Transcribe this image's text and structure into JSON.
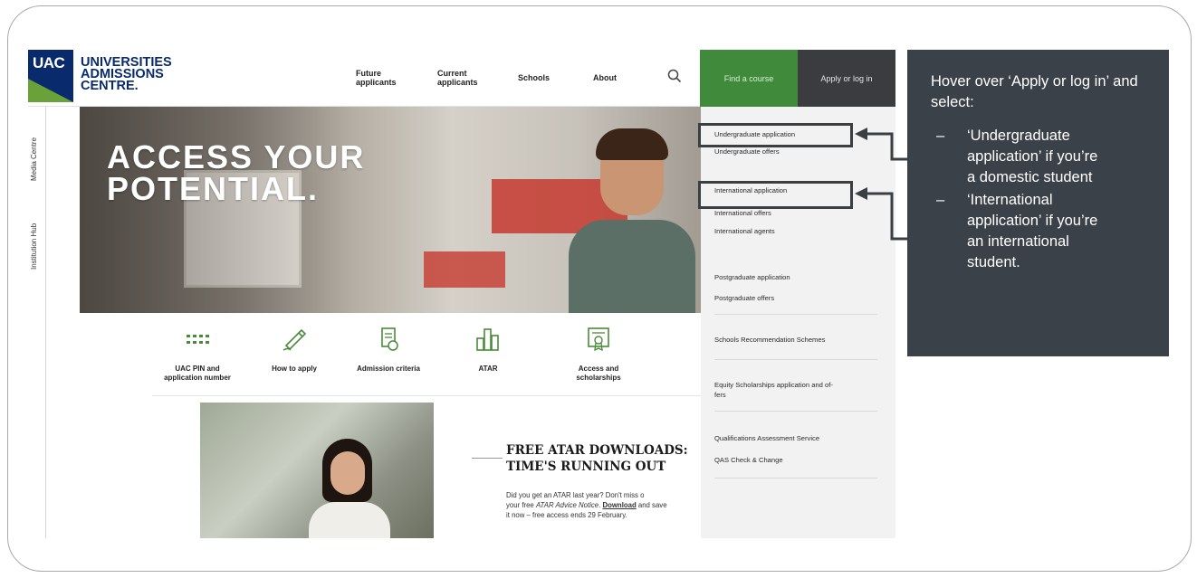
{
  "site": {
    "logo": {
      "short": "UAC",
      "line1": "UNIVERSITIES",
      "line2": "ADMISSIONS",
      "line3": "CENTRE."
    },
    "nav": [
      {
        "line1": "Future",
        "line2": "applicants"
      },
      {
        "line1": "Current",
        "line2": "applicants"
      },
      {
        "line1": "Schools",
        "line2": ""
      },
      {
        "line1": "About",
        "line2": ""
      }
    ],
    "find_course": "Find a course",
    "apply_login": "Apply or log in",
    "side_labels": {
      "media": "Media Centre",
      "institution": "Institution Hub"
    },
    "hero_line1": "ACCESS YOUR",
    "hero_line2": "POTENTIAL.",
    "quick_links": [
      {
        "line1": "UAC PIN and",
        "line2": "application number",
        "icon": "pin-dots-icon"
      },
      {
        "line1": "How to apply",
        "line2": "",
        "icon": "pencil-icon"
      },
      {
        "line1": "Admission criteria",
        "line2": "",
        "icon": "document-check-icon"
      },
      {
        "line1": "ATAR",
        "line2": "",
        "icon": "bar-chart-icon"
      },
      {
        "line1": "Access and",
        "line2": "scholarships",
        "icon": "certificate-icon"
      }
    ],
    "feature": {
      "title_line1": "FREE ATAR DOWNLOADS:",
      "title_line2": "TIME'S RUNNING OUT",
      "body_line1": "Did you get an ATAR last year? Don't miss o",
      "body_line2_a": "your free ",
      "body_line2_em": "ATAR Advice Notice",
      "body_line2_b": ". ",
      "body_line2_link": "Download",
      "body_line2_c": " and save",
      "body_line3": "it now – free access ends 29 February."
    },
    "dropdown": [
      "Undergraduate application",
      "Undergraduate offers",
      "International application",
      "International offers",
      "International agents",
      "Postgraduate application",
      "Postgraduate offers",
      "Schools Recommendation Schemes",
      "Equity Scholarships application and of-",
      "fers",
      "Qualifications Assessment Service",
      "QAS Check & Change"
    ]
  },
  "callout": {
    "intro": "Hover over ‘Apply or log in’ and select:",
    "bullets": [
      {
        "dash": "–",
        "lines": [
          "‘Undergraduate",
          "application’ if you’re",
          "a domestic student"
        ]
      },
      {
        "dash": "–",
        "lines": [
          "‘International",
          "application’ if you’re",
          "an international",
          "student."
        ]
      }
    ]
  },
  "colors": {
    "brand_navy": "#0a2a6e",
    "brand_green": "#6aa23a",
    "find_green": "#3f8a3b",
    "apply_dark": "#3a3c40",
    "callout_bg": "#3b4149"
  }
}
